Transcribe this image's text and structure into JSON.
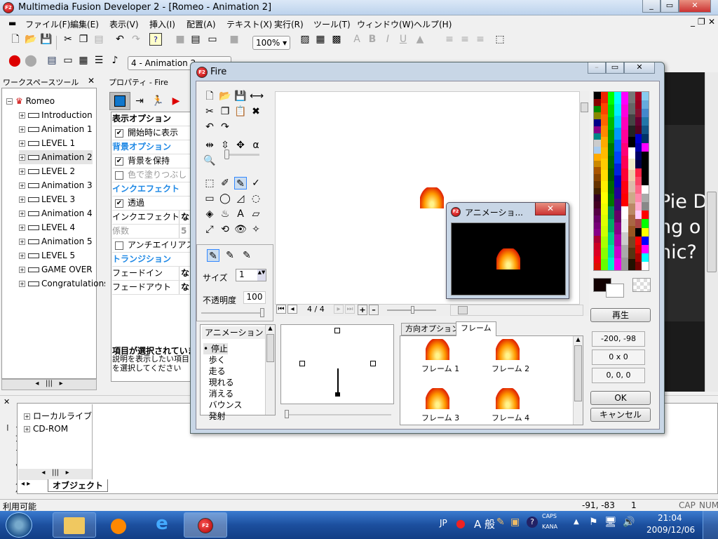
{
  "app": {
    "title": "Multimedia Fusion Developer 2 - [Romeo - Animation 2]"
  },
  "menu": [
    "ファイル(F)",
    "編集(E)",
    "表示(V)",
    "挿入(I)",
    "配置(A)",
    "テキスト(X)",
    "実行(R)",
    "ツール(T)",
    "ウィンドウ(W)",
    "ヘルプ(H)"
  ],
  "toolbar": {
    "zoom": "100%",
    "frame_select": "4 - Animation 2"
  },
  "workspace": {
    "title": "ワークスペースツール",
    "root": "Romeo",
    "items": [
      "Introduction",
      "Animation 1",
      "LEVEL 1",
      "Animation 2",
      "LEVEL 2",
      "Animation 3",
      "LEVEL 3",
      "Animation 4",
      "LEVEL 4",
      "Animation 5",
      "LEVEL 5",
      "GAME OVER",
      "Congratulations"
    ],
    "selected": "Animation 2"
  },
  "properties": {
    "title": "プロパティ - Fire",
    "rows": [
      {
        "type": "header",
        "label": "表示オプション"
      },
      {
        "type": "check",
        "label": "開始時に表示",
        "checked": true
      },
      {
        "type": "cat",
        "label": "背景オプション"
      },
      {
        "type": "check",
        "label": "背景を保持",
        "checked": true
      },
      {
        "type": "check",
        "label": "色で塗りつぶし",
        "checked": false,
        "disabled": true
      },
      {
        "type": "cat",
        "label": "インクエフェクト"
      },
      {
        "type": "check",
        "label": "透過",
        "checked": true
      },
      {
        "type": "kv",
        "label": "インクエフェクト",
        "value": "な"
      },
      {
        "type": "kv",
        "label": "係数",
        "value": "5",
        "disabled": true
      },
      {
        "type": "check",
        "label": "アンチエイリアス",
        "checked": false
      },
      {
        "type": "cat",
        "label": "トランジション"
      },
      {
        "type": "kv",
        "label": "フェードイン",
        "value": "な"
      },
      {
        "type": "kv",
        "label": "フェードアウト",
        "value": "な"
      }
    ],
    "help_title": "項目が選択されていません",
    "help_text": "説明を表示したい項目を選択してください"
  },
  "library": {
    "side_title": "ライブラリツールバー",
    "items": [
      "ローカルライブラリ",
      "CD-ROM"
    ],
    "tab": "オブジェクト"
  },
  "background_text": [
    "Pie D",
    "ng o",
    "nic?"
  ],
  "status": {
    "text": "利用可能",
    "coords": "-91, -83",
    "layer": "1",
    "cap": "CAP",
    "num": "NUM"
  },
  "dialog": {
    "title": "Fire",
    "size_label": "サイズ",
    "size": "1",
    "opacity_label": "不透明度",
    "opacity": "100",
    "frame_counter": "4 / 4",
    "anim_header": "アニメーション",
    "animations": [
      "停止",
      "歩く",
      "走る",
      "現れる",
      "消える",
      "バウンス",
      "発射"
    ],
    "selected_animation": "停止",
    "tabs": [
      "方向オプション",
      "フレーム"
    ],
    "active_tab": "フレーム",
    "frames": [
      "フレーム 1",
      "フレーム 2",
      "フレーム 3",
      "フレーム 4"
    ],
    "play": "再生",
    "hotspot": "-200, -98",
    "size_field": "0 x 0",
    "rgb_field": "0, 0, 0",
    "ok": "OK",
    "cancel": "キャンセル"
  },
  "preview": {
    "title": "アニメーショ..."
  },
  "taskbar": {
    "lang": "JP",
    "ime": "A 般",
    "caps": "CAPS",
    "kana": "KANA",
    "time": "21:04",
    "date": "2009/12/06"
  },
  "colors": {
    "accent": "#1e88e5",
    "taskbar": "#1c4f9e"
  }
}
